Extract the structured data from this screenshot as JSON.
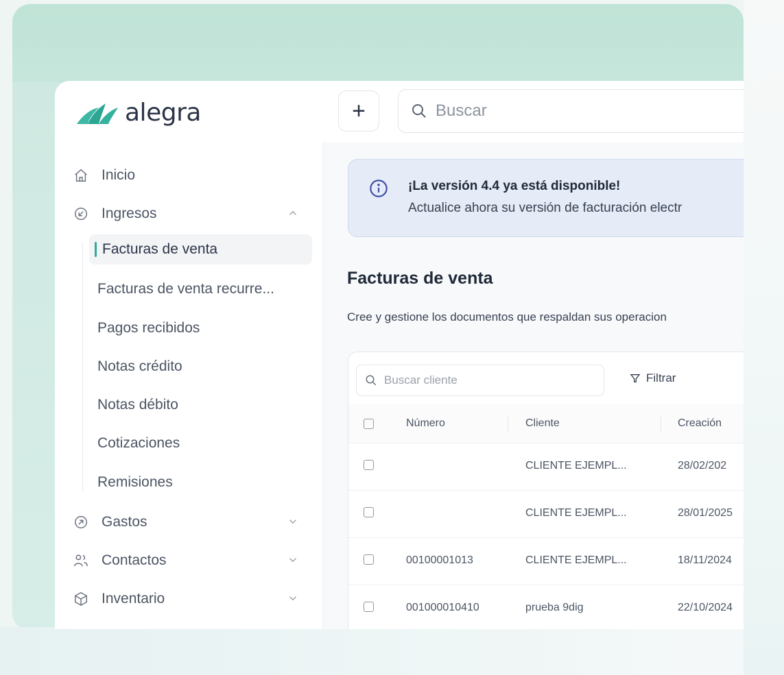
{
  "colors": {
    "brand": "#30aa97",
    "text_dark": "#1f2937",
    "banner_bg": "#e5ebf7",
    "info_blue": "#3b4ba3"
  },
  "header": {
    "logo_text": "alegra",
    "plus_label": "+",
    "search_placeholder": "Buscar"
  },
  "sidebar": {
    "items": [
      {
        "label": "Inicio",
        "icon": "home-icon"
      },
      {
        "label": "Ingresos",
        "icon": "income-arrow-icon",
        "expanded": true
      },
      {
        "label": "Gastos",
        "icon": "expense-arrow-icon"
      },
      {
        "label": "Contactos",
        "icon": "contacts-icon"
      },
      {
        "label": "Inventario",
        "icon": "box-icon"
      }
    ],
    "sub_items": [
      {
        "label": "Facturas de venta",
        "active": true
      },
      {
        "label": "Facturas de venta recurre..."
      },
      {
        "label": "Pagos recibidos"
      },
      {
        "label": "Notas crédito"
      },
      {
        "label": "Notas débito"
      },
      {
        "label": "Cotizaciones"
      },
      {
        "label": "Remisiones"
      }
    ]
  },
  "banner": {
    "title": "¡La versión 4.4 ya está disponible!",
    "text": "Actualice ahora su versión de facturación electr"
  },
  "main": {
    "page_title": "Facturas de venta",
    "description": "Cree y gestione los documentos que respaldan sus operacion"
  },
  "table": {
    "search_placeholder": "Buscar cliente",
    "filter_label": "Filtrar",
    "columns": [
      "Número",
      "Cliente",
      "Creación"
    ],
    "rows": [
      {
        "numero": "",
        "cliente": "CLIENTE EJEMPL...",
        "creacion": "28/02/202"
      },
      {
        "numero": "",
        "cliente": "CLIENTE EJEMPL...",
        "creacion": "28/01/2025"
      },
      {
        "numero": "00100001013",
        "cliente": "CLIENTE EJEMPL...",
        "creacion": "18/11/2024"
      },
      {
        "numero": "001000010410",
        "cliente": "prueba 9dig",
        "creacion": "22/10/2024"
      }
    ]
  }
}
